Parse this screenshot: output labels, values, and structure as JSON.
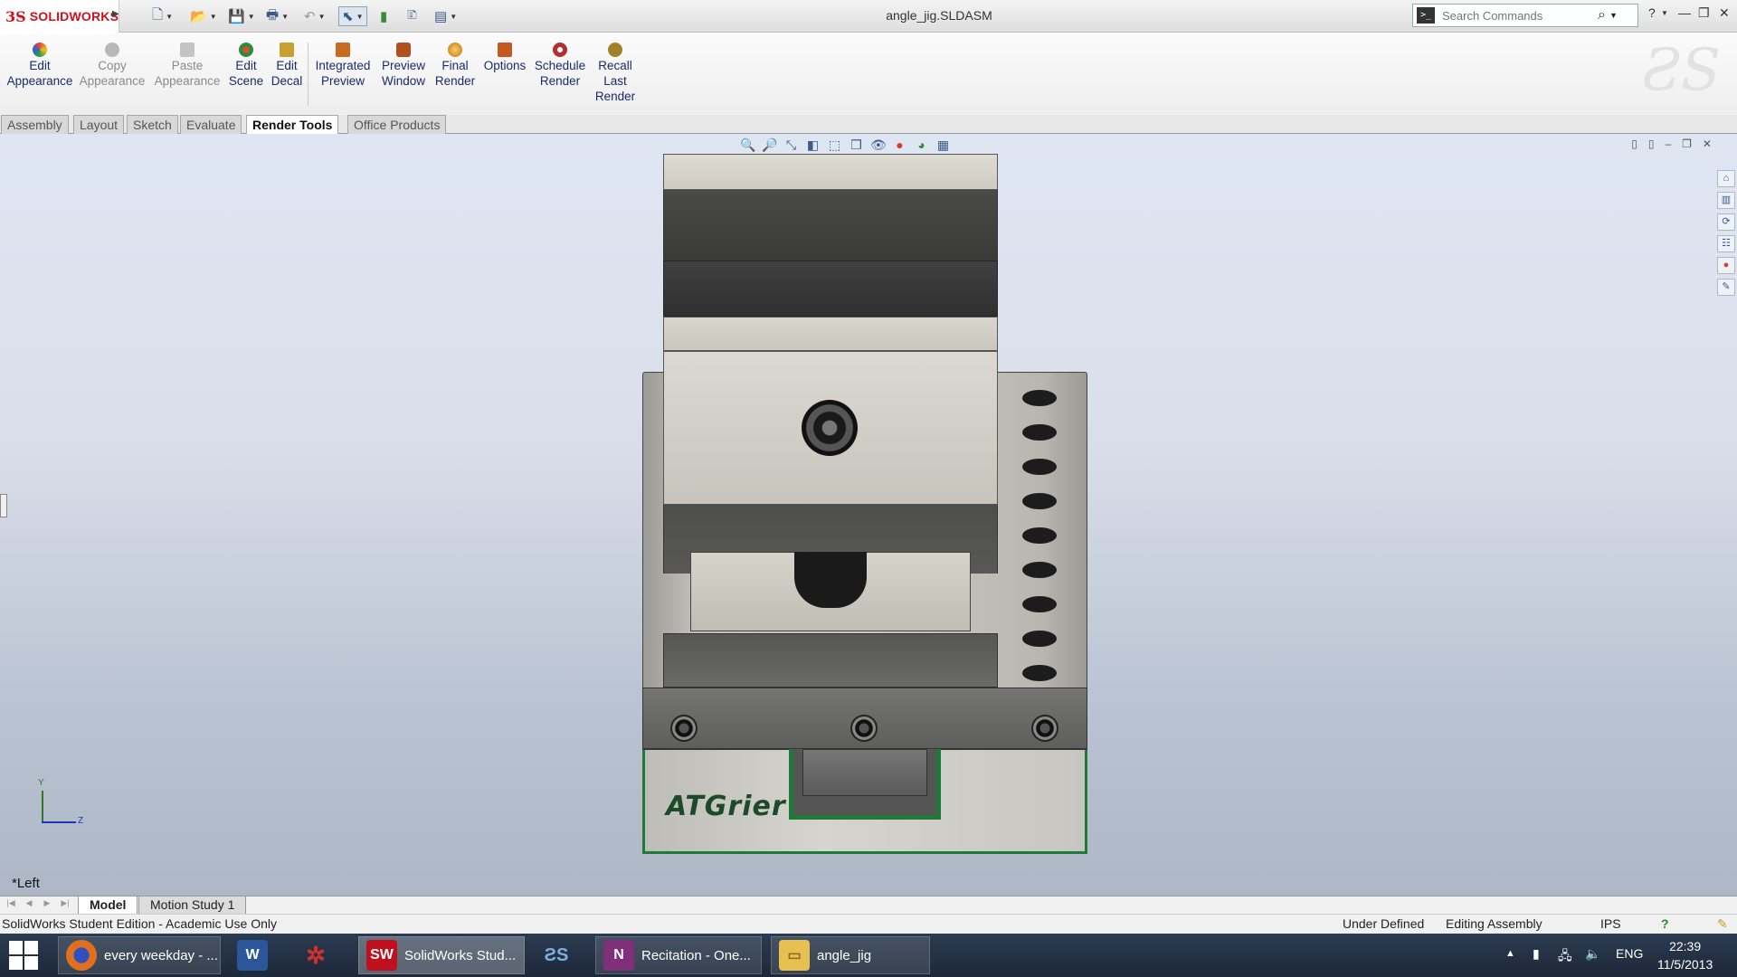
{
  "app": {
    "logo_mark": "3S",
    "logo_text": "SOLIDWORKS",
    "document_title": "angle_jig.SLDASM"
  },
  "search": {
    "placeholder": "Search Commands",
    "icon": "magnifier-icon"
  },
  "ribbon": {
    "buttons": [
      {
        "label": "Edit\nAppearance",
        "enabled": true,
        "icon_color": "#e04a3a"
      },
      {
        "label": "Copy\nAppearance",
        "enabled": false,
        "icon_color": "#9a9a9a"
      },
      {
        "label": "Paste\nAppearance",
        "enabled": false,
        "icon_color": "#9a9a9a"
      },
      {
        "label": "Edit\nScene",
        "enabled": true,
        "icon_color": "#2f8a3a"
      },
      {
        "label": "Edit\nDecal",
        "enabled": true,
        "icon_color": "#c8a030"
      },
      {
        "label": "Integrated\nPreview",
        "enabled": true,
        "icon_color": "#c86a20"
      },
      {
        "label": "Preview\nWindow",
        "enabled": true,
        "icon_color": "#b05020"
      },
      {
        "label": "Final\nRender",
        "enabled": true,
        "icon_color": "#e0a020"
      },
      {
        "label": "Options",
        "enabled": true,
        "icon_color": "#c05a20"
      },
      {
        "label": "Schedule\nRender",
        "enabled": true,
        "icon_color": "#b03030"
      },
      {
        "label": "Recall\nLast\nRender",
        "enabled": true,
        "icon_color": "#a0802a"
      }
    ]
  },
  "tabs": [
    {
      "label": "Assembly",
      "active": false
    },
    {
      "label": "Layout",
      "active": false
    },
    {
      "label": "Sketch",
      "active": false
    },
    {
      "label": "Evaluate",
      "active": false
    },
    {
      "label": "Render Tools",
      "active": true
    },
    {
      "label": "Office Products",
      "active": false
    }
  ],
  "viewport": {
    "engraving": "ATGrier",
    "view_name": "*Left",
    "triad": {
      "y_label": "Y",
      "z_label": "Z"
    }
  },
  "bottom_tabs": [
    {
      "label": "Model",
      "active": true
    },
    {
      "label": "Motion Study 1",
      "active": false
    }
  ],
  "status": {
    "left": "SolidWorks Student Edition - Academic Use Only",
    "state": "Under Defined",
    "mode": "Editing Assembly",
    "units": "IPS"
  },
  "taskbar": {
    "items": [
      {
        "label": "every weekday - ...",
        "icon": "firefox-icon"
      },
      {
        "label": "",
        "icon": "word-icon"
      },
      {
        "label": "",
        "icon": "zotero-icon"
      },
      {
        "label": "SolidWorks Stud...",
        "icon": "solidworks-icon"
      },
      {
        "label": "",
        "icon": "3dvia-icon"
      },
      {
        "label": "Recitation - One...",
        "icon": "onenote-icon"
      },
      {
        "label": "angle_jig",
        "icon": "folder-icon"
      }
    ],
    "language": "ENG",
    "time": "22:39",
    "date": "11/5/2013"
  },
  "colors": {
    "accent_red": "#d0101b",
    "plate_green": "#1f7a3a"
  }
}
